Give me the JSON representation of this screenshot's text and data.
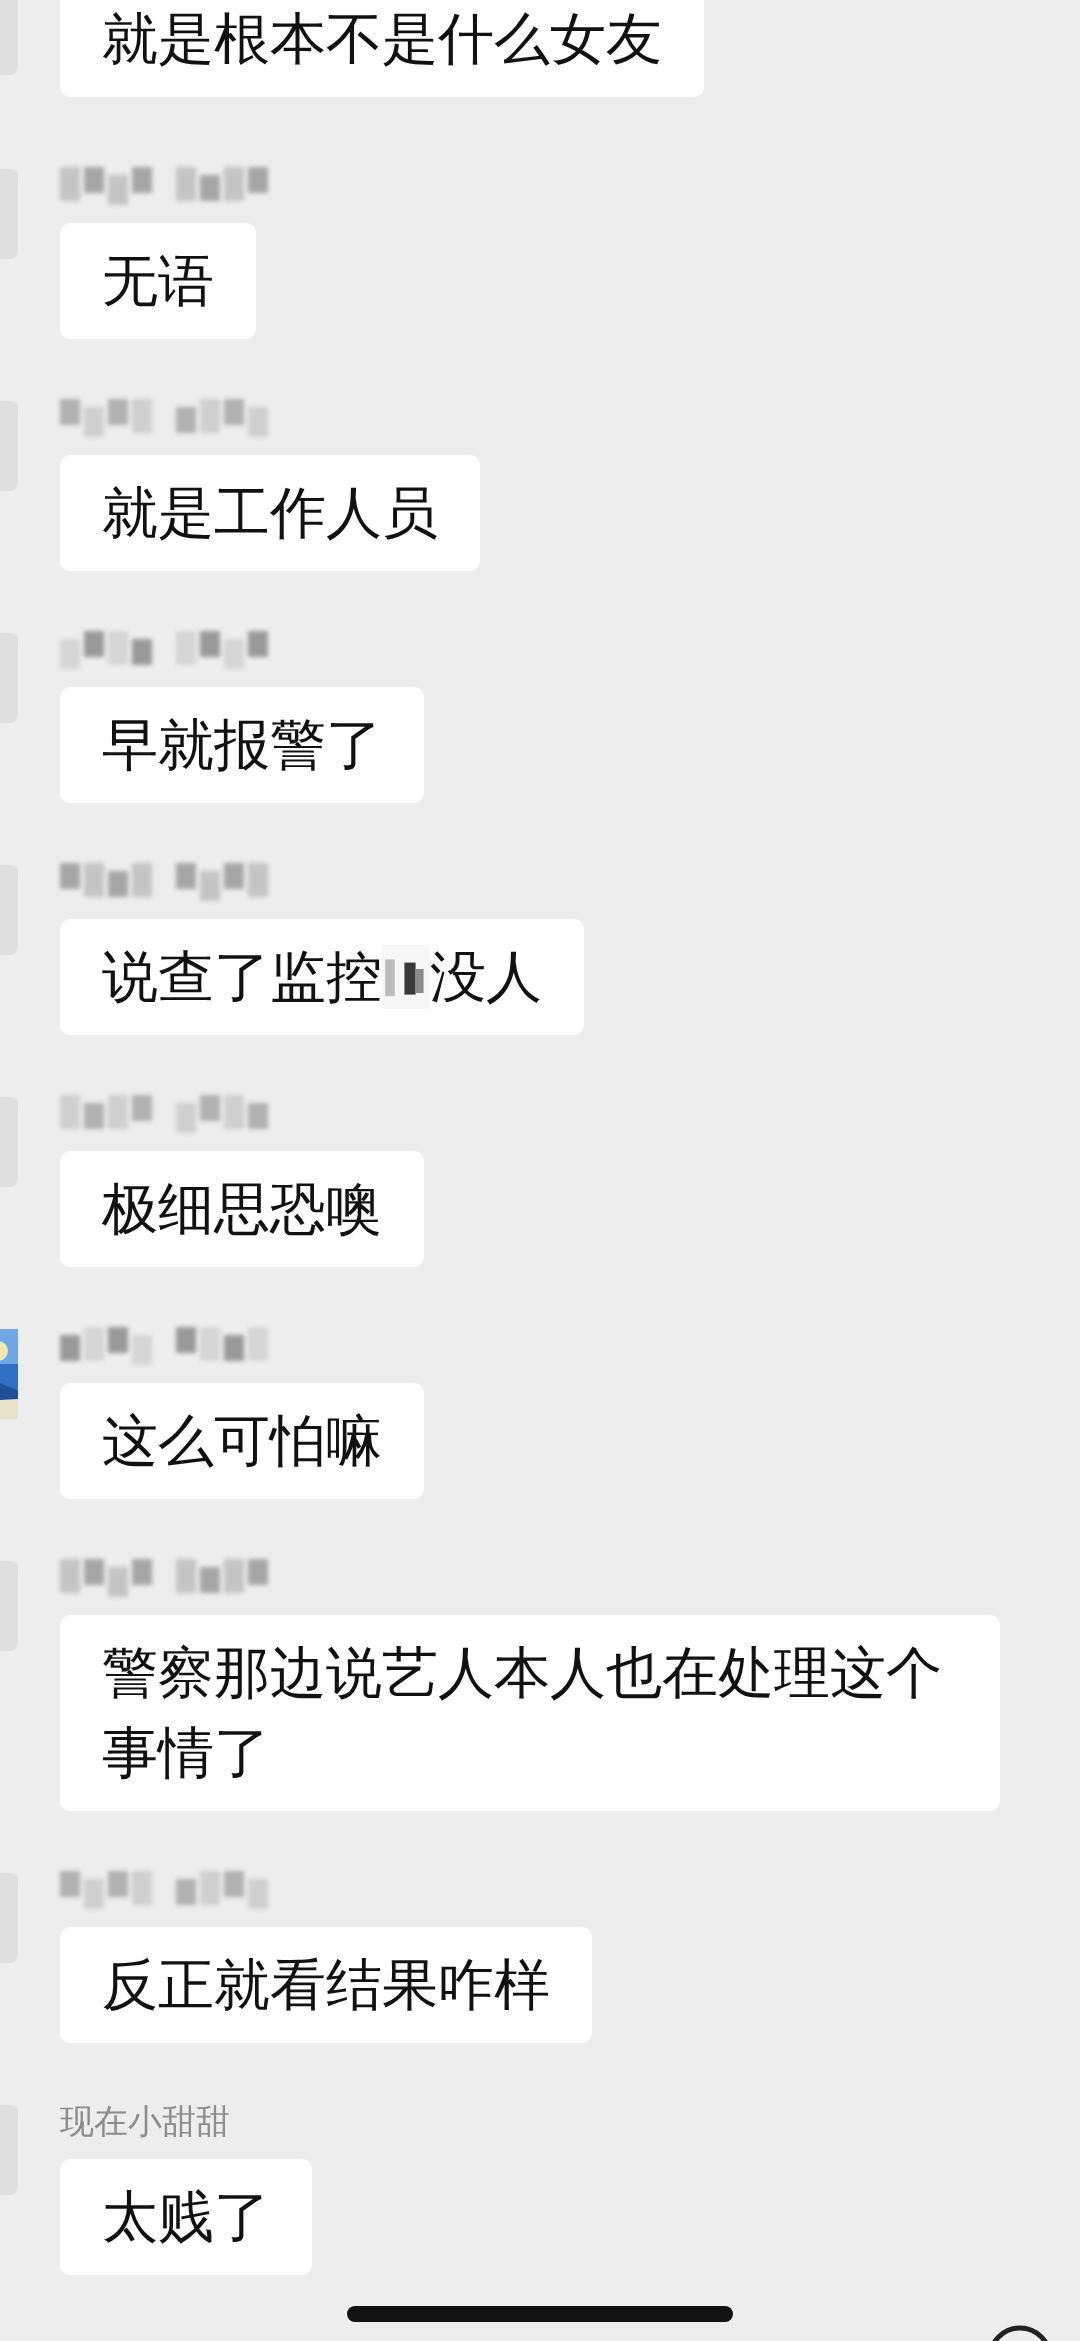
{
  "messages": [
    {
      "avatar": {
        "kind": "plain"
      },
      "parts": [
        {
          "kind": "text",
          "text": "就是根本不是什么女友"
        }
      ]
    },
    {
      "avatar": {
        "kind": "plain"
      },
      "sender": {
        "kind": "blurred"
      },
      "parts": [
        {
          "kind": "text",
          "text": "无语"
        }
      ]
    },
    {
      "avatar": {
        "kind": "plain"
      },
      "sender": {
        "kind": "blurred"
      },
      "parts": [
        {
          "kind": "text",
          "text": "就是工作人员"
        }
      ]
    },
    {
      "avatar": {
        "kind": "plain"
      },
      "sender": {
        "kind": "blurred"
      },
      "parts": [
        {
          "kind": "text",
          "text": "早就报警了"
        }
      ]
    },
    {
      "avatar": {
        "kind": "plain"
      },
      "sender": {
        "kind": "blurred"
      },
      "parts": [
        {
          "kind": "text",
          "text": "说查了监控"
        },
        {
          "kind": "mosaic"
        },
        {
          "kind": "text",
          "text": "没人"
        }
      ]
    },
    {
      "avatar": {
        "kind": "plain"
      },
      "sender": {
        "kind": "blurred"
      },
      "parts": [
        {
          "kind": "text",
          "text": "极细思恐噢"
        }
      ]
    },
    {
      "sender": {
        "kind": "blurred"
      },
      "parts": [
        {
          "kind": "text",
          "text": "这么可怕嘛"
        }
      ]
    },
    {
      "avatar": {
        "kind": "plain"
      },
      "sender": {
        "kind": "blurred"
      },
      "parts": [
        {
          "kind": "text",
          "text": "警察那边说艺人本人也在处理这个事情了"
        }
      ]
    },
    {
      "avatar": {
        "kind": "plain"
      },
      "sender": {
        "kind": "blurred"
      },
      "parts": [
        {
          "kind": "text",
          "text": "反正就看结果咋样"
        }
      ]
    },
    {
      "avatar": {
        "kind": "plain"
      },
      "sender": {
        "kind": "text",
        "text": "现在小甜甜"
      },
      "parts": [
        {
          "kind": "text",
          "text": "太贱了"
        }
      ]
    }
  ]
}
